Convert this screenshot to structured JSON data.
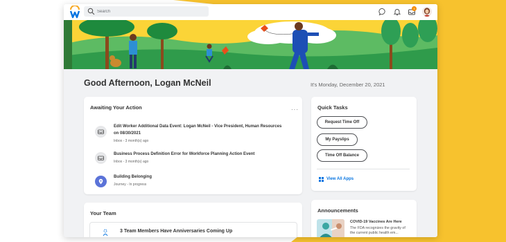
{
  "search": {
    "placeholder": "Search"
  },
  "topbar": {
    "notifications_badge": "3",
    "icons": [
      "chat-icon",
      "bell-icon",
      "inbox-icon"
    ]
  },
  "greeting": "Good Afternoon, Logan McNeil",
  "date": "It's Monday, December 20, 2021",
  "awaiting": {
    "title": "Awaiting Your Action",
    "more": "···",
    "items": [
      {
        "icon": "inbox-tray-icon",
        "title": "Edit Worker Additional Data Event: Logan McNeil - Vice President, Human Resources on 08/30/2021",
        "meta": "Inbox - 3 month(s) ago"
      },
      {
        "icon": "inbox-tray-icon",
        "title": "Business Process Definition Error for Workforce Planning Action Event",
        "meta": "Inbox - 3 month(s) ago"
      },
      {
        "icon": "location-pin-icon",
        "title": "Building Belonging",
        "meta": "Journey - In progress"
      }
    ]
  },
  "quick_tasks": {
    "title": "Quick Tasks",
    "buttons": [
      "Request Time Off",
      "My Payslips",
      "Time Off Balance"
    ],
    "view_all": "View All Apps"
  },
  "team": {
    "title": "Your Team",
    "item": "3 Team Members Have Anniversaries Coming Up"
  },
  "announcements": {
    "title": "Announcements",
    "item_title": "COVID-19 Vaccines Are Here",
    "item_body": "The FDA recognizes the gravity of the current public health em..."
  },
  "colors": {
    "accent": "#0875e1",
    "brand_yellow": "#f7c22e",
    "badge": "#f38b00",
    "journey": "#5b73d8"
  }
}
